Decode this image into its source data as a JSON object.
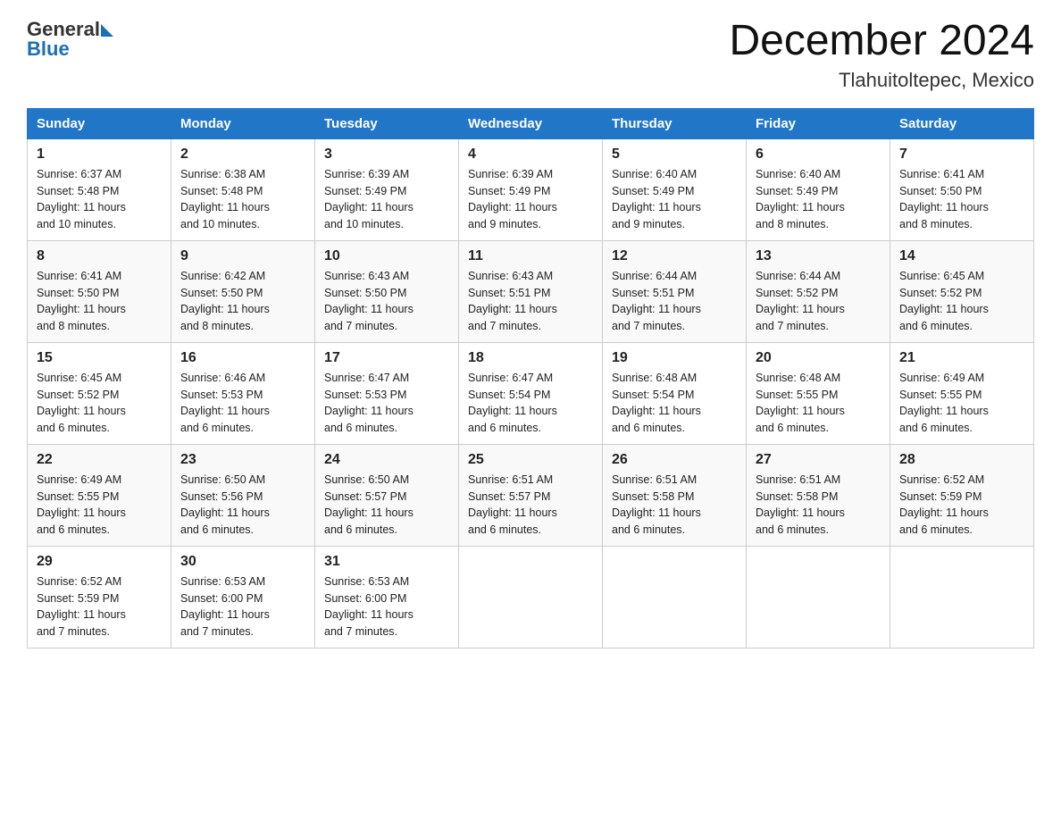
{
  "header": {
    "logo_text": "General",
    "logo_blue": "Blue",
    "month_title": "December 2024",
    "location": "Tlahuitoltepec, Mexico"
  },
  "days_of_week": [
    "Sunday",
    "Monday",
    "Tuesday",
    "Wednesday",
    "Thursday",
    "Friday",
    "Saturday"
  ],
  "weeks": [
    [
      {
        "day": "1",
        "sunrise": "6:37 AM",
        "sunset": "5:48 PM",
        "daylight": "11 hours and 10 minutes."
      },
      {
        "day": "2",
        "sunrise": "6:38 AM",
        "sunset": "5:48 PM",
        "daylight": "11 hours and 10 minutes."
      },
      {
        "day": "3",
        "sunrise": "6:39 AM",
        "sunset": "5:49 PM",
        "daylight": "11 hours and 10 minutes."
      },
      {
        "day": "4",
        "sunrise": "6:39 AM",
        "sunset": "5:49 PM",
        "daylight": "11 hours and 9 minutes."
      },
      {
        "day": "5",
        "sunrise": "6:40 AM",
        "sunset": "5:49 PM",
        "daylight": "11 hours and 9 minutes."
      },
      {
        "day": "6",
        "sunrise": "6:40 AM",
        "sunset": "5:49 PM",
        "daylight": "11 hours and 8 minutes."
      },
      {
        "day": "7",
        "sunrise": "6:41 AM",
        "sunset": "5:50 PM",
        "daylight": "11 hours and 8 minutes."
      }
    ],
    [
      {
        "day": "8",
        "sunrise": "6:41 AM",
        "sunset": "5:50 PM",
        "daylight": "11 hours and 8 minutes."
      },
      {
        "day": "9",
        "sunrise": "6:42 AM",
        "sunset": "5:50 PM",
        "daylight": "11 hours and 8 minutes."
      },
      {
        "day": "10",
        "sunrise": "6:43 AM",
        "sunset": "5:50 PM",
        "daylight": "11 hours and 7 minutes."
      },
      {
        "day": "11",
        "sunrise": "6:43 AM",
        "sunset": "5:51 PM",
        "daylight": "11 hours and 7 minutes."
      },
      {
        "day": "12",
        "sunrise": "6:44 AM",
        "sunset": "5:51 PM",
        "daylight": "11 hours and 7 minutes."
      },
      {
        "day": "13",
        "sunrise": "6:44 AM",
        "sunset": "5:52 PM",
        "daylight": "11 hours and 7 minutes."
      },
      {
        "day": "14",
        "sunrise": "6:45 AM",
        "sunset": "5:52 PM",
        "daylight": "11 hours and 6 minutes."
      }
    ],
    [
      {
        "day": "15",
        "sunrise": "6:45 AM",
        "sunset": "5:52 PM",
        "daylight": "11 hours and 6 minutes."
      },
      {
        "day": "16",
        "sunrise": "6:46 AM",
        "sunset": "5:53 PM",
        "daylight": "11 hours and 6 minutes."
      },
      {
        "day": "17",
        "sunrise": "6:47 AM",
        "sunset": "5:53 PM",
        "daylight": "11 hours and 6 minutes."
      },
      {
        "day": "18",
        "sunrise": "6:47 AM",
        "sunset": "5:54 PM",
        "daylight": "11 hours and 6 minutes."
      },
      {
        "day": "19",
        "sunrise": "6:48 AM",
        "sunset": "5:54 PM",
        "daylight": "11 hours and 6 minutes."
      },
      {
        "day": "20",
        "sunrise": "6:48 AM",
        "sunset": "5:55 PM",
        "daylight": "11 hours and 6 minutes."
      },
      {
        "day": "21",
        "sunrise": "6:49 AM",
        "sunset": "5:55 PM",
        "daylight": "11 hours and 6 minutes."
      }
    ],
    [
      {
        "day": "22",
        "sunrise": "6:49 AM",
        "sunset": "5:55 PM",
        "daylight": "11 hours and 6 minutes."
      },
      {
        "day": "23",
        "sunrise": "6:50 AM",
        "sunset": "5:56 PM",
        "daylight": "11 hours and 6 minutes."
      },
      {
        "day": "24",
        "sunrise": "6:50 AM",
        "sunset": "5:57 PM",
        "daylight": "11 hours and 6 minutes."
      },
      {
        "day": "25",
        "sunrise": "6:51 AM",
        "sunset": "5:57 PM",
        "daylight": "11 hours and 6 minutes."
      },
      {
        "day": "26",
        "sunrise": "6:51 AM",
        "sunset": "5:58 PM",
        "daylight": "11 hours and 6 minutes."
      },
      {
        "day": "27",
        "sunrise": "6:51 AM",
        "sunset": "5:58 PM",
        "daylight": "11 hours and 6 minutes."
      },
      {
        "day": "28",
        "sunrise": "6:52 AM",
        "sunset": "5:59 PM",
        "daylight": "11 hours and 6 minutes."
      }
    ],
    [
      {
        "day": "29",
        "sunrise": "6:52 AM",
        "sunset": "5:59 PM",
        "daylight": "11 hours and 7 minutes."
      },
      {
        "day": "30",
        "sunrise": "6:53 AM",
        "sunset": "6:00 PM",
        "daylight": "11 hours and 7 minutes."
      },
      {
        "day": "31",
        "sunrise": "6:53 AM",
        "sunset": "6:00 PM",
        "daylight": "11 hours and 7 minutes."
      },
      null,
      null,
      null,
      null
    ]
  ],
  "labels": {
    "sunrise_prefix": "Sunrise: ",
    "sunset_prefix": "Sunset: ",
    "daylight_prefix": "Daylight: "
  }
}
